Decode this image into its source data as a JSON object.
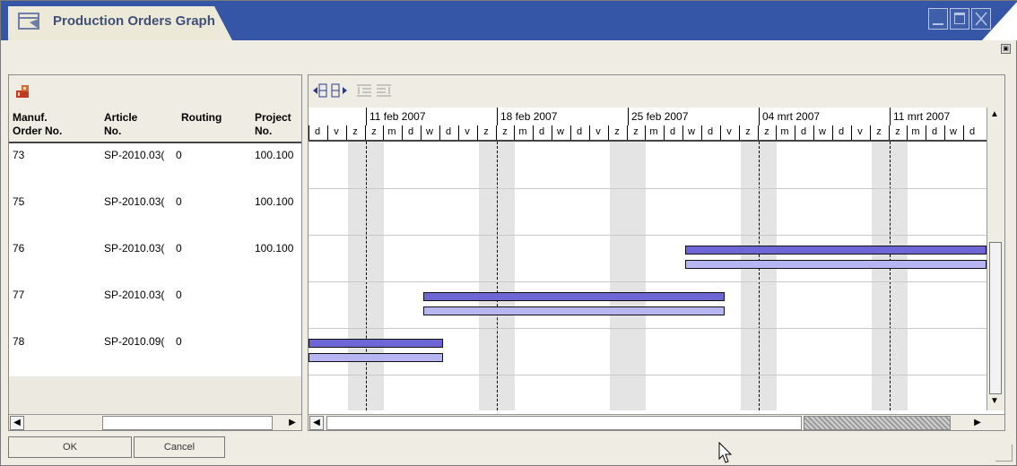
{
  "window": {
    "title": "Production Orders Graph"
  },
  "left_table": {
    "headers": [
      {
        "line1": "Manuf.",
        "line2": "Order No."
      },
      {
        "line1": "Article",
        "line2": "No."
      },
      {
        "line1": "Routing",
        "line2": ""
      },
      {
        "line1": "Project",
        "line2": "No."
      }
    ],
    "rows": [
      {
        "order": "73",
        "article": "SP-2010.03(",
        "routing": "0",
        "project": "100.100"
      },
      {
        "order": "75",
        "article": "SP-2010.03(",
        "routing": "0",
        "project": "100.100"
      },
      {
        "order": "76",
        "article": "SP-2010.03(",
        "routing": "0",
        "project": "100.100"
      },
      {
        "order": "77",
        "article": "SP-2010.03(",
        "routing": "0",
        "project": ""
      },
      {
        "order": "78",
        "article": "SP-2010.09(",
        "routing": "0",
        "project": ""
      }
    ]
  },
  "gantt": {
    "weeks": [
      "11 feb 2007",
      "18 feb 2007",
      "25 feb 2007",
      "04 mrt 2007",
      "11 mrt 2007"
    ],
    "days": [
      "d",
      "v",
      "z",
      "z",
      "m",
      "d",
      "w",
      "d",
      "v",
      "z",
      "z",
      "m",
      "d",
      "w",
      "d",
      "v",
      "z",
      "z",
      "m",
      "d",
      "w",
      "d",
      "v",
      "z",
      "z",
      "m",
      "d",
      "w",
      "d",
      "v",
      "z",
      "z",
      "m",
      "d",
      "w",
      "d"
    ]
  },
  "buttons": {
    "ok": "OK",
    "cancel": "Cancel"
  },
  "colors": {
    "titlebar": "#3556a6",
    "bar_primary": "#6f66d6",
    "bar_secondary": "#b7b6f2"
  }
}
